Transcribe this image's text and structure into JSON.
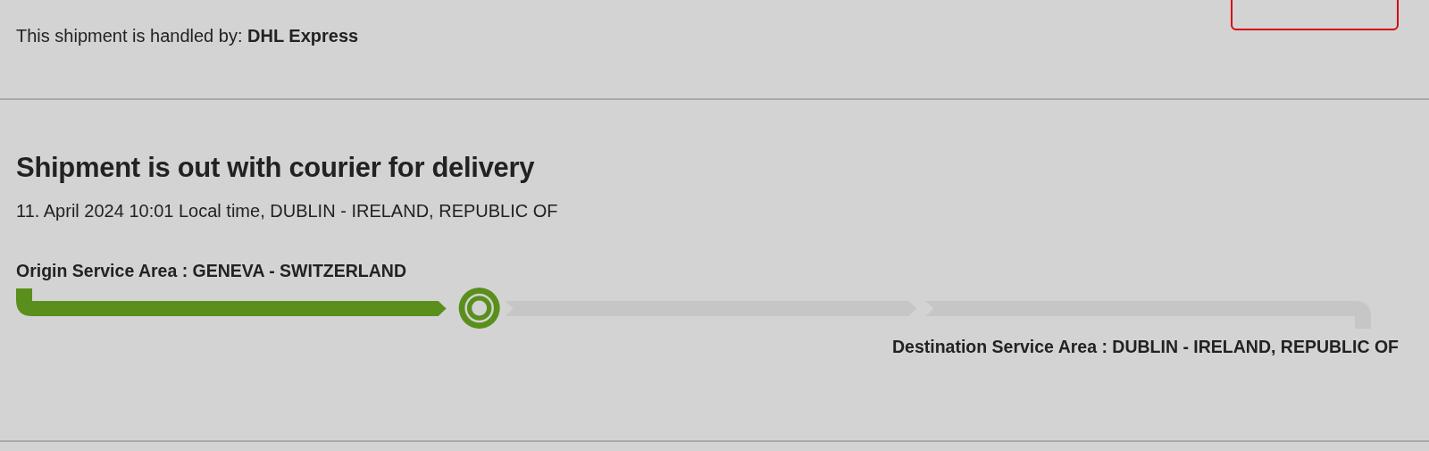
{
  "handler": {
    "text": "This shipment is handled by: **DHL Express**"
  },
  "status": {
    "title": "Shipment is out with courier for delivery",
    "timestamp": "11. April 2024 10:01 Local time, DUBLIN - IRELAND, REPUBLIC OF"
  },
  "progress": {
    "origin": "Origin Service Area : GENEVA - SWITZERLAND",
    "destination": "Destination Service Area : DUBLIN - IRELAND, REPUBLIC OF",
    "segments": [
      {
        "completed": true
      },
      {
        "completed": false
      },
      {
        "completed": false
      }
    ]
  }
}
